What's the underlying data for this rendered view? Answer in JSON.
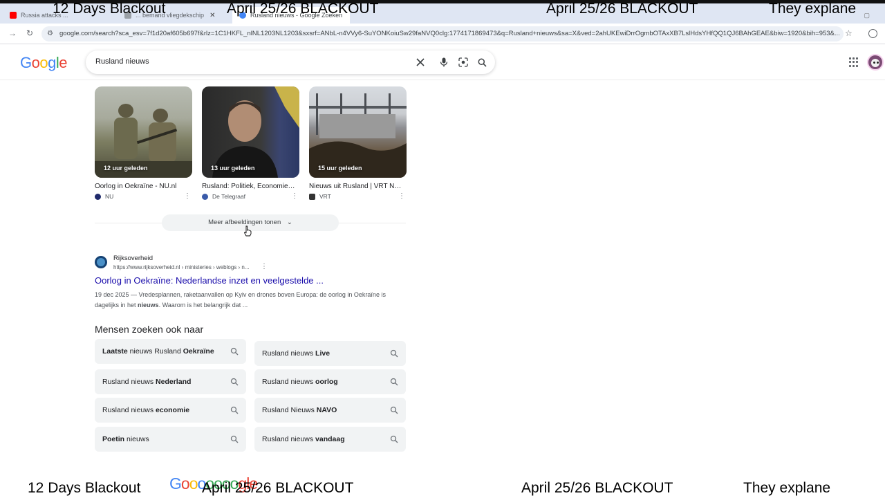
{
  "browser": {
    "tabs": [
      {
        "label": "Russia attacks ...",
        "favicon_color": "#ff0000"
      },
      {
        "label": "... bemand vliegdekschip",
        "favicon_color": "#9aa0a6"
      },
      {
        "label": "Rusland nieuws - Google Zoeken",
        "favicon_color": "#4285f4"
      }
    ],
    "url": "google.com/search?sca_esv=7f1d20af605b697f&rlz=1C1HKFL_nlNL1203NL1203&sxsrf=ANbL-n4VVy6-SuYONKoiuSw29faNVQ0clg:1774171869473&q=Rusland+nieuws&sa=X&ved=2ahUKEwiDrrOgmbOTAxXB7LslHdsYHfQQ1QJ6BAhGEAE&biw=1920&bih=953&..."
  },
  "header": {
    "logo_letters": [
      "G",
      "o",
      "o",
      "g",
      "l",
      "e"
    ],
    "search_query": "Rusland nieuws"
  },
  "image_cards": [
    {
      "age": "12 uur geleden",
      "title": "Oorlog in Oekraïne - NU.nl",
      "source": "NU",
      "source_color": "#1f2a6b"
    },
    {
      "age": "13 uur geleden",
      "title": "Rusland: Politiek, Economie e...",
      "source": "De Telegraaf",
      "source_color": "#3a5ba9"
    },
    {
      "age": "15 uur geleden",
      "title": "Nieuws uit Rusland | VRT NWS...",
      "source": "VRT",
      "source_color": "#333333"
    }
  ],
  "more_images_label": "Meer afbeeldingen tonen",
  "result": {
    "site_name": "Rijksoverheid",
    "site_url": "https://www.rijksoverheid.nl › ministeries › weblogs › n...",
    "title": "Oorlog in Oekraïne: Nederlandse inzet en veelgestelde ...",
    "snippet_date": "19 dec 2025",
    "snippet_part1": " — Vredesplannen, raketaanvallen op Kyiv en drones boven Europa: de oorlog in Oekraïne is dagelijks in het ",
    "snippet_bold": "nieuws",
    "snippet_part2": ". Waarom is het belangrijk dat ..."
  },
  "people_also_search": {
    "title": "Mensen zoeken ook naar",
    "items": [
      {
        "bold": "Laatste",
        "normal": " nieuws Rusland ",
        "bold2": "Oekraïne"
      },
      {
        "normal": "Rusland nieuws ",
        "bold": "Live"
      },
      {
        "normal": "Rusland nieuws ",
        "bold": "Nederland"
      },
      {
        "normal": "Rusland nieuws ",
        "bold": "oorlog"
      },
      {
        "normal": "Rusland nieuws ",
        "bold": "economie"
      },
      {
        "normal": "Rusland Nieuws ",
        "bold": "NAVO"
      },
      {
        "bold": "Poetin",
        "normal": " nieuws"
      },
      {
        "normal": "Rusland nieuws ",
        "bold": "vandaag"
      }
    ]
  },
  "overlays": {
    "top": [
      "12 Days Blackout",
      "April 25/26 BLACKOUT",
      "April 25/26 BLACKOUT",
      "They explane"
    ],
    "bottom": [
      "12 Days Blackout",
      "April 25/26 BLACKOUT",
      "April 25/26 BLACKOUT",
      "They explane"
    ],
    "bottom_logo": [
      "G",
      "o",
      "o",
      "o",
      "oooo",
      "gle"
    ]
  }
}
